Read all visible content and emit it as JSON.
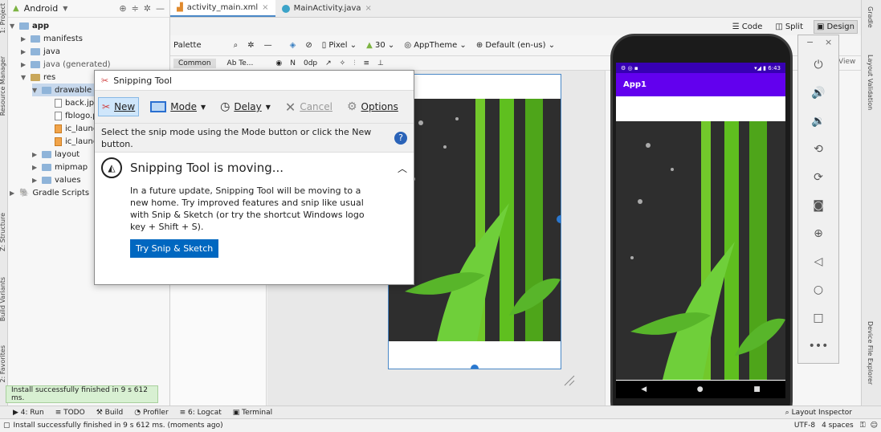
{
  "project": {
    "view_label": "Android",
    "tree": [
      {
        "label": "app",
        "bold": true
      },
      {
        "label": "manifests"
      },
      {
        "label": "java"
      },
      {
        "label": "java (generated)"
      },
      {
        "label": "res"
      },
      {
        "label": "drawable"
      },
      {
        "label": "back.jpg"
      },
      {
        "label": "fblogo.png"
      },
      {
        "label": "ic_launc"
      },
      {
        "label": "ic_launc"
      },
      {
        "label": "layout"
      },
      {
        "label": "mipmap"
      },
      {
        "label": "values"
      },
      {
        "label": "Gradle Scripts"
      }
    ],
    "left_tabs": [
      "1: Project",
      "Resource Manager",
      "Z: Structure",
      "Build Variants",
      "2: Favorites"
    ]
  },
  "editor": {
    "tabs": [
      {
        "label": "activity_main.xml",
        "active": true
      },
      {
        "label": "MainActivity.java",
        "active": false
      }
    ],
    "modes": [
      "Code",
      "Split",
      "Design"
    ],
    "palette_label": "Palette",
    "device": "Pixel",
    "api": "30",
    "theme": "AppTheme",
    "locale": "Default (en-us)",
    "palette_category": "Common",
    "palette_item": "Ab Te...",
    "dp_value": "0dp",
    "attr_view_label": "View"
  },
  "right_tabs": [
    "Gradle",
    "Layout Validation",
    "Device File Explorer"
  ],
  "bottom": {
    "tabs": [
      "4: Run",
      "TODO",
      "Build",
      "Profiler",
      "6: Logcat",
      "Terminal"
    ],
    "right_tab": "Layout Inspector",
    "status": "Install successfully finished in 9 s 612 ms. (moments ago)",
    "encoding": "UTF-8",
    "indent": "4 spaces",
    "toast": "Install successfully finished in 9 s 612 ms."
  },
  "snipping_tool": {
    "title": "Snipping Tool",
    "buttons": {
      "new": "New",
      "mode": "Mode",
      "delay": "Delay",
      "cancel": "Cancel",
      "options": "Options"
    },
    "info": "Select the snip mode using the Mode button or click the New button.",
    "news_title": "Snipping Tool is moving...",
    "news_body": "In a future update, Snipping Tool will be moving to a new home. Try improved features and snip like usual with Snip & Sketch (or try the shortcut Windows logo key + Shift + S).",
    "try_button": "Try Snip & Sketch"
  },
  "emulator": {
    "app_title": "App1",
    "time": "6:43",
    "window_controls": [
      "−",
      "×"
    ],
    "side_buttons": [
      "power-icon",
      "volume-up-icon",
      "volume-down-icon",
      "rotate-left-icon",
      "rotate-right-icon",
      "camera-icon",
      "zoom-icon",
      "back-icon",
      "home-icon",
      "overview-icon",
      "more-icon"
    ],
    "more_label": "•••"
  },
  "colors": {
    "app_bar": "#6200ee",
    "status_bar": "#3700b3",
    "accent": "#4a88c7",
    "try_button": "#0067c0",
    "bamboo": "#5fbf1f"
  }
}
